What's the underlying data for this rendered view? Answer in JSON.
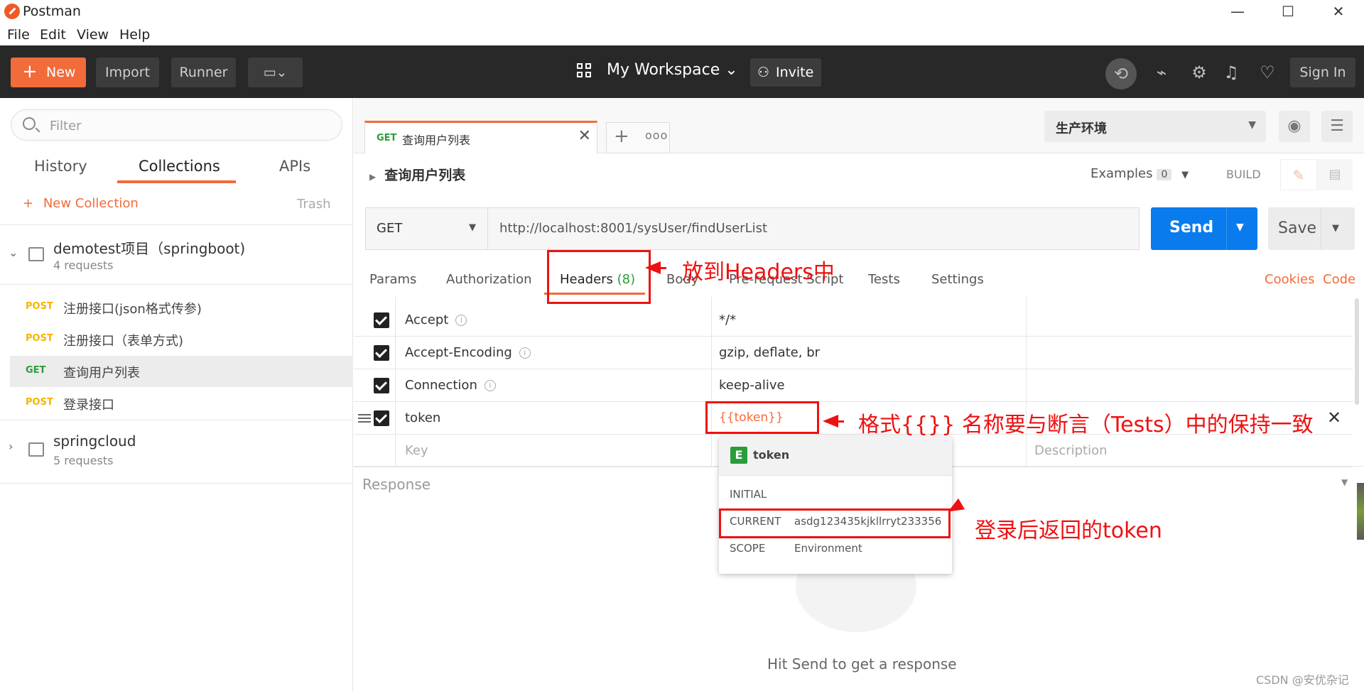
{
  "app": {
    "title": "Postman",
    "window_controls": {
      "minimize": "—",
      "maximize": "☐",
      "close": "✕"
    },
    "menu": [
      "File",
      "Edit",
      "View",
      "Help"
    ]
  },
  "header": {
    "new_label": "New",
    "import_label": "Import",
    "runner_label": "Runner",
    "workspace_label": "My Workspace",
    "invite_label": "Invite",
    "signin_label": "Sign In",
    "icons": [
      "sync-off-icon",
      "satellite-icon",
      "settings-icon",
      "bell-icon",
      "heart-icon"
    ]
  },
  "sidebar": {
    "filter_placeholder": "Filter",
    "tabs": [
      "History",
      "Collections",
      "APIs"
    ],
    "active_tab": "Collections",
    "new_collection_label": "New Collection",
    "trash_label": "Trash",
    "collections": [
      {
        "name": "demotest项目（springboot)",
        "count": "4 requests",
        "expanded": true,
        "requests": [
          {
            "method": "POST",
            "name": "注册接口(json格式传参)"
          },
          {
            "method": "POST",
            "name": "注册接口（表单方式)"
          },
          {
            "method": "GET",
            "name": "查询用户列表",
            "selected": true
          },
          {
            "method": "POST",
            "name": "登录接口"
          }
        ]
      },
      {
        "name": "springcloud",
        "count": "5 requests",
        "expanded": false
      }
    ]
  },
  "request_tab": {
    "method": "GET",
    "name": "查询用户列表"
  },
  "environment": {
    "selected": "生产环境"
  },
  "request": {
    "title": "查询用户列表",
    "examples_label": "Examples",
    "examples_count": "0",
    "build_label": "BUILD",
    "method": "GET",
    "url": "http://localhost:8001/sysUser/findUserList",
    "send_label": "Send",
    "save_label": "Save"
  },
  "subtabs": {
    "params": "Params",
    "authorization": "Authorization",
    "headers": "Headers",
    "headers_count": "(8)",
    "body": "Body",
    "prerequest": "Pre-request Script",
    "tests": "Tests",
    "settings": "Settings",
    "cookies": "Cookies",
    "code": "Code"
  },
  "headers_table": {
    "rows": [
      {
        "key": "Accept",
        "value": "*/*",
        "info": true
      },
      {
        "key": "Accept-Encoding",
        "value": "gzip, deflate, br",
        "info": true
      },
      {
        "key": "Connection",
        "value": "keep-alive",
        "info": true
      },
      {
        "key": "token",
        "value": "{{token}}",
        "info": false
      }
    ],
    "key_placeholder": "Key",
    "description_placeholder": "Description"
  },
  "variable_popup": {
    "badge": "E",
    "name": "token",
    "initial_label": "INITIAL",
    "current_label": "CURRENT",
    "current_value": "asdg123435kjkllrryt233356",
    "scope_label": "SCOPE",
    "scope_value": "Environment"
  },
  "response": {
    "label": "Response",
    "empty_message": "Hit Send to get a response"
  },
  "annotations": {
    "headers_note": "放到Headers中",
    "token_note": "格式{{}}  名称要与断言（Tests）中的保持一致",
    "current_note": "登录后返回的token"
  },
  "watermark": "CSDN @安优杂记",
  "colors": {
    "accent": "#f26b3a",
    "send_blue": "#097bed",
    "get_green": "#2a9d3a",
    "post_yellow": "#f4b400",
    "annotation_red": "#ee1111"
  }
}
